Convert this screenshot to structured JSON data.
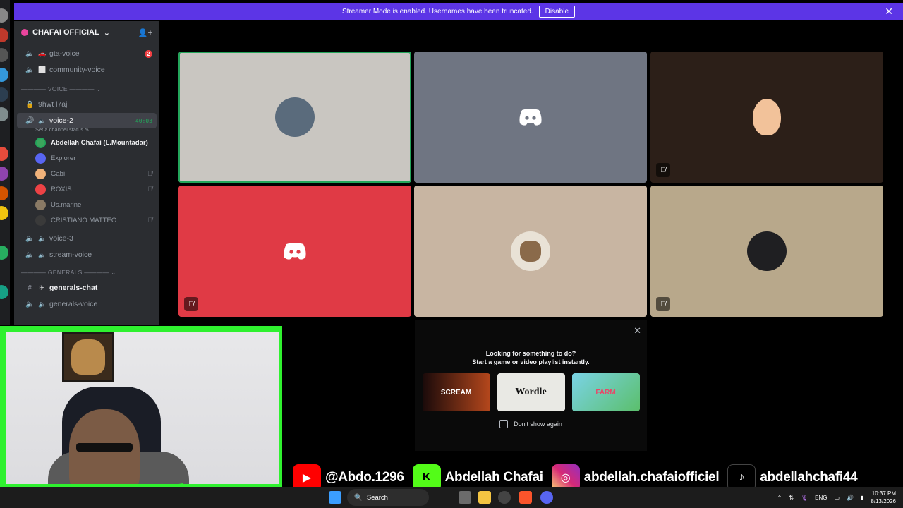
{
  "banner": {
    "message": "Streamer Mode is enabled. Usernames have been truncated.",
    "disable_label": "Disable",
    "close": "✕"
  },
  "sidebar": {
    "server_name": "CHAFAI OFFICIAL",
    "channels_top": [
      {
        "name": "gta-voice",
        "badge": "2"
      },
      {
        "name": "community-voice"
      }
    ],
    "voice_category": "VOICE",
    "locked_channel": "9hwt l7aj",
    "active_channel": {
      "name": "voice-2",
      "timer": "40:03",
      "status": "Set a channel status"
    },
    "members": [
      {
        "name": "Abdellah Chafai (L.Mountadar)",
        "color": "#3ba55c"
      },
      {
        "name": "Explorer",
        "color": "#5865f2"
      },
      {
        "name": "Gabi",
        "color": "#f0b27a"
      },
      {
        "name": "ROXIS",
        "color": "#ed4245"
      },
      {
        "name": "Us.marine",
        "color": "#8a7a65"
      },
      {
        "name": "CRISTIANO MATTEO",
        "color": "#c8a46c"
      }
    ],
    "channels_after": [
      {
        "name": "voice-3"
      },
      {
        "name": "stream-voice"
      }
    ],
    "generals_category": "GENERALS",
    "generals_channels": [
      {
        "name": "generals-chat"
      },
      {
        "name": "generals-voice"
      }
    ]
  },
  "activity": {
    "title_line1": "Looking for something to do?",
    "title_line2": "Start a game or video playlist instantly.",
    "cards": [
      "SCREAM",
      "Wordle",
      "FARM"
    ],
    "dont_show": "Don't show again"
  },
  "social": {
    "youtube": "@Abdo.1296",
    "kick": "Abdellah Chafai",
    "instagram": "abdellah.chafaiofficiel",
    "tiktok": "abdellahchafi44"
  },
  "taskbar": {
    "search_label": "Search",
    "lang": "ENG",
    "time": "10:37 PM",
    "date": "8/13/2026"
  },
  "colors": {
    "banner": "#5c35e6",
    "speaking": "#23a55a",
    "discord_red_tile": "#e03a45",
    "discord_grey_tile": "#6f7582"
  }
}
